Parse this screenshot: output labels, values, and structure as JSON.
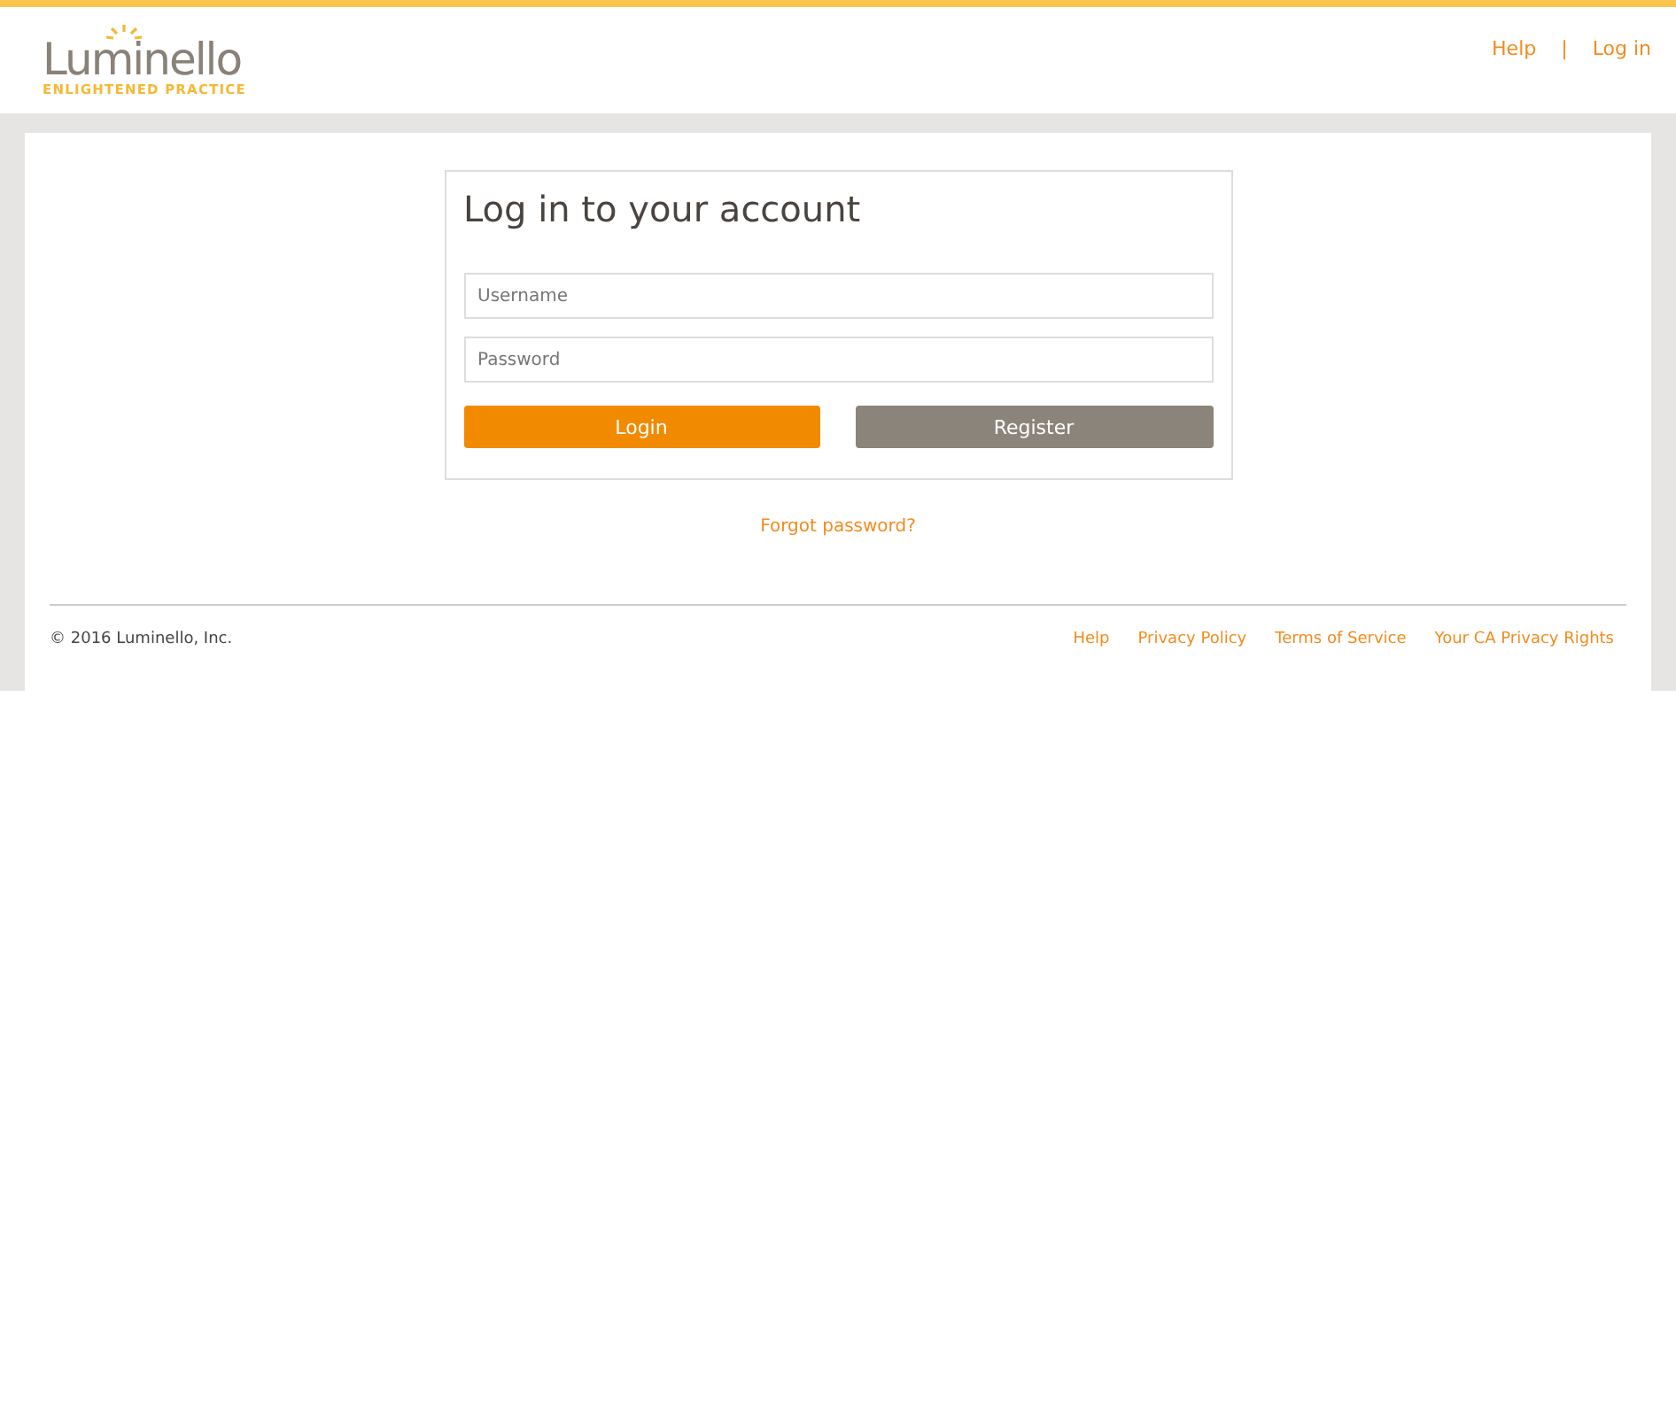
{
  "header": {
    "logo": {
      "name": "Luminello",
      "tagline": "ENLIGHTENED PRACTICE"
    },
    "links": [
      {
        "label": "Help"
      },
      {
        "label": "Log in"
      }
    ],
    "separator": "|"
  },
  "login_card": {
    "title": "Log in to your account",
    "fields": [
      {
        "placeholder": "Username"
      },
      {
        "placeholder": "Password"
      }
    ],
    "buttons": [
      {
        "label": "Login",
        "kind": "primary"
      },
      {
        "label": "Register",
        "kind": "secondary"
      }
    ]
  },
  "forgot_link": "Forgot password?",
  "footer": {
    "copyright": "© 2016 Luminello, Inc.",
    "links": [
      {
        "label": "Help"
      },
      {
        "label": "Privacy Policy"
      },
      {
        "label": "Terms of Service"
      },
      {
        "label": "Your CA Privacy Rights"
      }
    ]
  }
}
